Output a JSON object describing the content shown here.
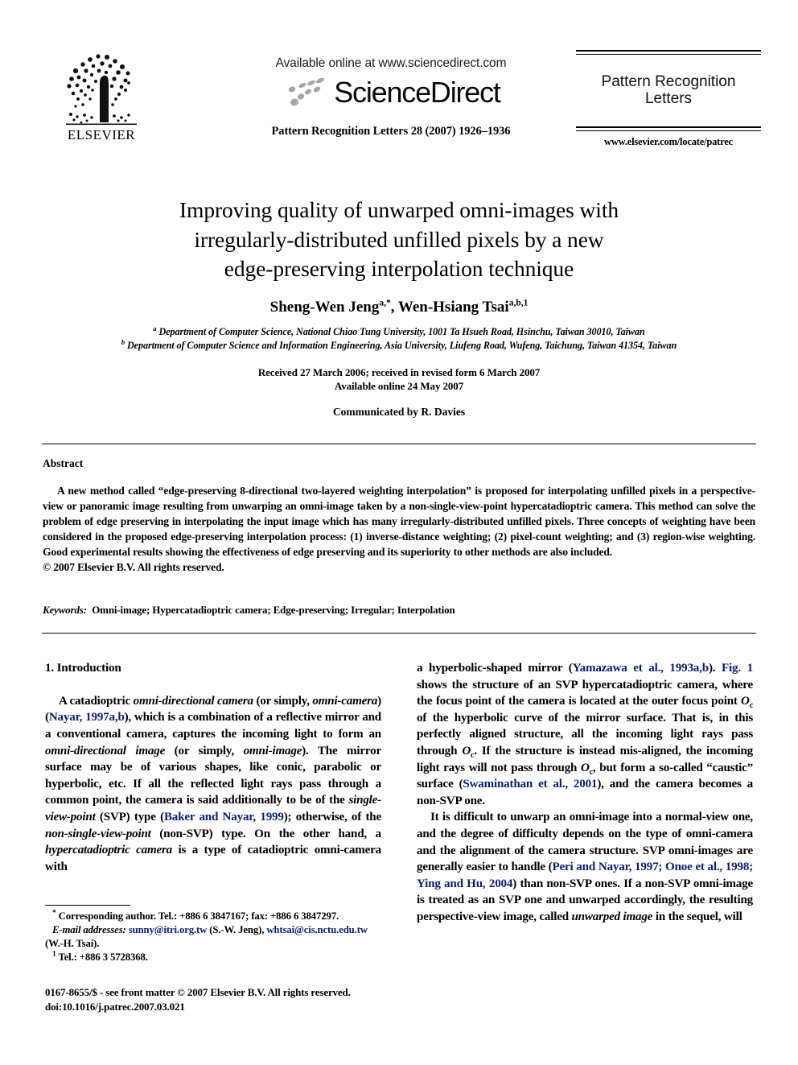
{
  "masthead": {
    "publisher_name": "ELSEVIER",
    "publisher_logo_icon": "elsevier-tree-logo",
    "available_online": "Available online at www.sciencedirect.com",
    "sciencedirect_wordmark": "ScienceDirect",
    "sciencedirect_logo_icon": "sciencedirect-swoosh-icon",
    "journal_citation": "Pattern Recognition Letters 28 (2007) 1926–1936",
    "journal_name_line1": "Pattern Recognition",
    "journal_name_line2": "Letters",
    "journal_url": "www.elsevier.com/locate/patrec"
  },
  "article": {
    "title_line1": "Improving quality of unwarped omni-images with",
    "title_line2": "irregularly-distributed unfilled pixels by a new",
    "title_line3": "edge-preserving interpolation technique",
    "author1_name": "Sheng-Wen Jeng",
    "author1_marks": "a,*",
    "author_separator": ", ",
    "author2_name": "Wen-Hsiang Tsai",
    "author2_marks": "a,b,1",
    "affiliation_a_mark": "a",
    "affiliation_a": "Department of Computer Science, National Chiao Tung University, 1001 Ta Hsueh Road, Hsinchu, Taiwan 30010, Taiwan",
    "affiliation_b_mark": "b",
    "affiliation_b": "Department of Computer Science and Information Engineering, Asia University, Liufeng Road, Wufeng, Taichung, Taiwan 41354, Taiwan",
    "received_line": "Received 27 March 2006; received in revised form 6 March 2007",
    "available_line": "Available online 24 May 2007",
    "communicated_by": "Communicated by R. Davies"
  },
  "abstract": {
    "heading": "Abstract",
    "text": "A new method called “edge-preserving 8-directional two-layered weighting interpolation” is proposed for interpolating unfilled pixels in a perspective-view or panoramic image resulting from unwarping an omni-image taken by a non-single-view-point hypercatadioptric camera. This method can solve the problem of edge preserving in interpolating the input image which has many irregularly-distributed unfilled pixels. Three concepts of weighting have been considered in the proposed edge-preserving interpolation process: (1) inverse-distance weighting; (2) pixel-count weighting; and (3) region-wise weighting. Good experimental results showing the effectiveness of edge preserving and its superiority to other methods are also included.",
    "copyright": "© 2007 Elsevier B.V. All rights reserved.",
    "keywords_label": "Keywords:",
    "keywords_value": "Omni-image; Hypercatadioptric camera; Edge-preserving; Irregular; Interpolation"
  },
  "body": {
    "section_heading": "1. Introduction",
    "left_p1": {
      "s1": "A catadioptric ",
      "i1": "omni-directional camera",
      "s2": " (or simply, ",
      "i2": "omni-camera",
      "s3": ") (",
      "c1": "Nayar, 1997a,b",
      "s4": "), which is a combination of a reflective mirror and a conventional camera, captures the incoming light to form an ",
      "i3": "omni-directional image",
      "s5": " (or simply, ",
      "i4": "omni-image",
      "s6": "). The mirror surface may be of various shapes, like conic, parabolic or hyperbolic, etc. If all the reflected light rays pass through a common point, the camera is said additionally to be of the ",
      "i5": "single-view-point",
      "s7": " (SVP) type (",
      "c2": "Baker and Nayar, 1999",
      "s8": "); otherwise, of the ",
      "i6": "non-single-view-point",
      "s9": " (non-SVP) type. On the other hand, a ",
      "i7": "hypercatadioptric camera",
      "s10": " is a type of catadioptric omni-camera with"
    },
    "right_p1": {
      "s1": "a hyperbolic-shaped mirror (",
      "c1": "Yamazawa et al., 1993a,b",
      "s2": "). ",
      "c2": "Fig. 1",
      "s3": " shows the structure of an SVP hypercatadioptric camera, where the focus point of the camera is located at the outer focus point ",
      "m1": "O",
      "m1sub": "c",
      "s4": " of the hyperbolic curve of the mirror surface. That is, in this perfectly aligned structure, all the incoming light rays pass through ",
      "m2": "O",
      "m2sub": "c",
      "s5": ". If the structure is instead mis-aligned, the incoming light rays will not pass through ",
      "m3": "O",
      "m3sub": "c",
      "s6": ", but form a so-called “caustic” surface (",
      "c3": "Swaminathan et al., 2001",
      "s7": "), and the camera becomes a non-SVP one."
    },
    "right_p2": {
      "s1": "It is difficult to unwarp an omni-image into a normal-view one, and the degree of difficulty depends on the type of omni-camera and the alignment of the camera structure. SVP omni-images are generally easier to handle (",
      "c1": "Peri and Nayar, 1997; Onoe et al., 1998; Ying and Hu, 2004",
      "s2": ") than non-SVP ones. If a non-SVP omni-image is treated as an SVP one and unwarped accordingly, the resulting perspective-view image, called ",
      "i1": "unwarped image",
      "s3": " in the sequel, will"
    }
  },
  "footnotes": {
    "corresponding_mark": "*",
    "corresponding": "Corresponding author. Tel.: +886 6 3847167; fax: +886 6 3847297.",
    "email_label": "E-mail addresses:",
    "email1": "sunny@itri.org.tw",
    "email1_owner": "(S.-W. Jeng),",
    "email2": "whtsai@cis.nctu.edu.tw",
    "email2_owner": "(W.-H. Tsai).",
    "tel_mark": "1",
    "tel": "Tel.: +886 3 5728368."
  },
  "imprint": {
    "issn_line": "0167-8655/$ - see front matter © 2007 Elsevier B.V. All rights reserved.",
    "doi_line": "doi:10.1016/j.patrec.2007.03.021"
  },
  "colors": {
    "citation_link": "#0b1f72",
    "text": "#000000",
    "background": "#ffffff"
  }
}
